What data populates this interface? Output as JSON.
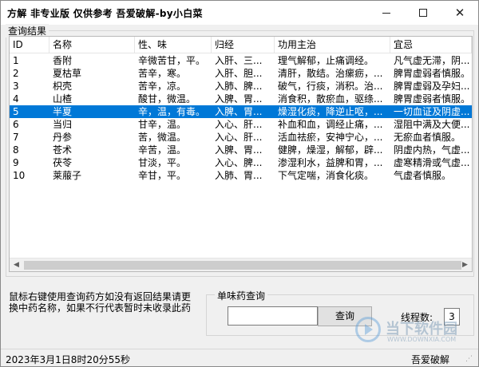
{
  "window": {
    "title": "方解 非专业版  仅供参考 吾爱破解-by小白菜",
    "minimize_icon": "minimize-icon",
    "maximize_icon": "maximize-icon",
    "close_icon": "close-icon",
    "close_glyph": "✕"
  },
  "results": {
    "group_label": "查询结果",
    "columns": [
      "ID",
      "名称",
      "性、味",
      "归经",
      "功用主治",
      "宜忌"
    ],
    "rows": [
      {
        "id": "1",
        "name": "香附",
        "prop": "辛微苦甘，平。",
        "mer": "入肝、三...",
        "eff": "理气解郁，止痛调经。",
        "note": "凡气虚无滞，阴..."
      },
      {
        "id": "2",
        "name": "夏枯草",
        "prop": "苦辛，寒。",
        "mer": "入肝、胆...",
        "eff": "清肝，散结。治瘰疬，...",
        "note": "脾胃虚弱者慎服。"
      },
      {
        "id": "3",
        "name": "枳壳",
        "prop": "苦辛，凉。",
        "mer": "入肺、脾...",
        "eff": "破气，行痰，消积。治...",
        "note": "脾胃虚弱及孕妇..."
      },
      {
        "id": "4",
        "name": "山楂",
        "prop": "酸甘，微温。",
        "mer": "入脾、胃...",
        "eff": "消食积，散瘀血，驱绦...",
        "note": "脾胃虚弱者慎服。"
      },
      {
        "id": "5",
        "name": "半夏",
        "prop": "辛，温，有毒。",
        "mer": "入脾、胃...",
        "eff": "燥湿化痰，降逆止呕，...",
        "note": "一切血证及阴虚..."
      },
      {
        "id": "6",
        "name": "当归",
        "prop": "甘辛，温。",
        "mer": "入心、肝...",
        "eff": "补血和血，调经止痛，...",
        "note": "湿阻中满及大便..."
      },
      {
        "id": "7",
        "name": "丹参",
        "prop": "苦，微温。",
        "mer": "入心、肝...",
        "eff": "活血祛瘀，安神宁心，...",
        "note": "无瘀血者慎服。"
      },
      {
        "id": "8",
        "name": "苍术",
        "prop": "辛苦，温。",
        "mer": "入脾、胃...",
        "eff": "健脾，燥湿，解郁，辟...",
        "note": "阴虚内热，气虚..."
      },
      {
        "id": "9",
        "name": "茯苓",
        "prop": "甘淡，平。",
        "mer": "入心、脾...",
        "eff": "渗湿利水，益脾和胃，...",
        "note": "虚寒精滑或气虚..."
      },
      {
        "id": "10",
        "name": "莱菔子",
        "prop": "辛甘，平。",
        "mer": "入肺、胃...",
        "eff": "下气定喘，消食化痰。",
        "note": "气虚者慎服。"
      }
    ],
    "selected_row": 5,
    "selection_color": "#0078d7",
    "scroll_left_icon": "scroll-left-icon",
    "scroll_right_icon": "scroll-right-icon",
    "scroll_left_glyph": "◀",
    "scroll_right_glyph": "▶"
  },
  "hint": "鼠标右键使用查询药方如没有返回结果请更换中药名称，如果不行代表暂时未收录此药",
  "search": {
    "group_label": "单味药查询",
    "input_value": "",
    "button_label": "查询",
    "threads_label": "线程数:",
    "threads_value": "3"
  },
  "status": {
    "datetime": "2023年3月1日8时20分55秒",
    "credit": "吾爱破解"
  },
  "watermark": {
    "text": "当下软件园",
    "sub": "WWW.DOWNXIA.COM"
  }
}
